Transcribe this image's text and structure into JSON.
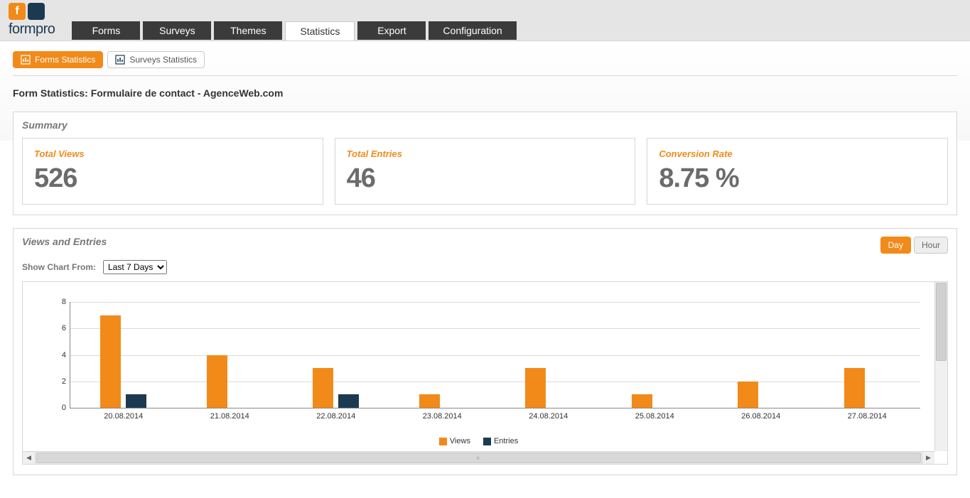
{
  "brand": {
    "name": "formpro",
    "logo_letter": "f"
  },
  "nav": {
    "tabs": [
      {
        "label": "Forms"
      },
      {
        "label": "Surveys"
      },
      {
        "label": "Themes"
      },
      {
        "label": "Statistics",
        "active": true
      },
      {
        "label": "Export"
      },
      {
        "label": "Configuration"
      }
    ]
  },
  "subtabs": {
    "forms_stats": "Forms Statistics",
    "surveys_stats": "Surveys Statistics"
  },
  "page_title": "Form Statistics: Formulaire de contact - AgenceWeb.com",
  "summary": {
    "title": "Summary",
    "cards": {
      "views": {
        "label": "Total Views",
        "value": "526"
      },
      "entries": {
        "label": "Total Entries",
        "value": "46"
      },
      "conv": {
        "label": "Conversion Rate",
        "value": "8.75 %"
      }
    }
  },
  "chart_panel": {
    "title": "Views and Entries",
    "filter_label": "Show Chart From:",
    "filter_value": "Last 7 Days",
    "toggle": {
      "day": "Day",
      "hour": "Hour",
      "active": "day"
    }
  },
  "chart_data": {
    "type": "bar",
    "categories": [
      "20.08.2014",
      "21.08.2014",
      "22.08.2014",
      "23.08.2014",
      "24.08.2014",
      "25.08.2014",
      "26.08.2014",
      "27.08.2014"
    ],
    "series": [
      {
        "name": "Views",
        "values": [
          7,
          4,
          3,
          1,
          3,
          1,
          2,
          3
        ]
      },
      {
        "name": "Entries",
        "values": [
          1,
          0,
          1,
          0,
          0,
          0,
          0,
          0
        ]
      }
    ],
    "ylabel": "",
    "xlabel": "",
    "ylim": [
      0,
      8
    ],
    "y_ticks": [
      0,
      2,
      4,
      6,
      8
    ],
    "legend": [
      "Views",
      "Entries"
    ],
    "colors": {
      "Views": "#f28a1a",
      "Entries": "#1b3a52"
    }
  }
}
